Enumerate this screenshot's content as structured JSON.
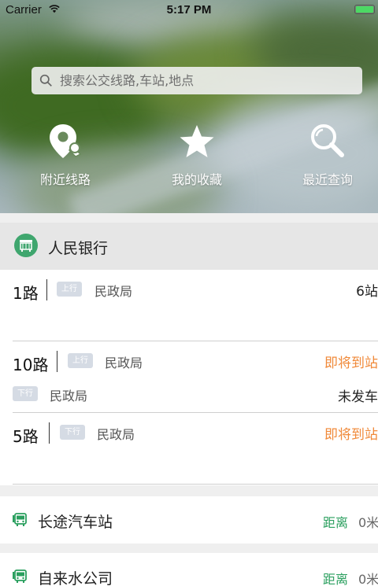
{
  "status_bar": {
    "carrier": "Carrier",
    "time": "5:17 PM",
    "battery_level": 1.0
  },
  "search": {
    "placeholder": "搜索公交线路,车站,地点",
    "icon": "search-icon"
  },
  "quick_actions": [
    {
      "label": "附近线路",
      "icon": "location-pin-icon"
    },
    {
      "label": "我的收藏",
      "icon": "star-icon"
    },
    {
      "label": "最近查询",
      "icon": "magnifier-icon"
    }
  ],
  "station": {
    "name": "人民银行",
    "icon": "bus-stop-icon",
    "routes": [
      {
        "number": "1路",
        "tag": "上行",
        "stop": "民政局",
        "status": "6站"
      },
      {
        "number": "10路",
        "tag": "上行",
        "stop": "民政局",
        "status": "即将到站",
        "sub": {
          "tag": "下行",
          "stop": "民政局",
          "status": "未发车"
        }
      },
      {
        "number": "5路",
        "tag": "下行",
        "stop": "民政局",
        "status": "即将到站"
      }
    ]
  },
  "nearby": [
    {
      "name": "长途汽车站",
      "distance_label": "距离",
      "distance": "0米"
    },
    {
      "name": "自来水公司",
      "distance_label": "距离",
      "distance": "0米"
    }
  ],
  "colors": {
    "accent_green": "#2a9f5e",
    "status_orange": "#f08a3a",
    "tag_bg": "#d5dbe4"
  }
}
